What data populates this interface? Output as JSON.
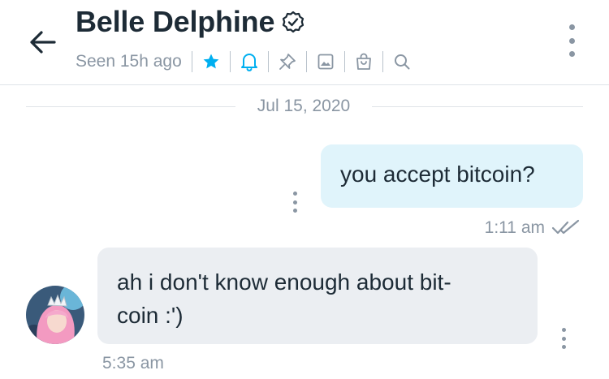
{
  "header": {
    "contact_name": "Belle Delphine",
    "status": "Seen 15h ago",
    "toolbar": [
      {
        "icon": "star-icon",
        "color": "#00aff0"
      },
      {
        "icon": "bell-icon",
        "color": "#00aff0"
      },
      {
        "icon": "pin-icon",
        "color": "#8a96a3"
      },
      {
        "icon": "image-icon",
        "color": "#8a96a3"
      },
      {
        "icon": "shopping-bag-icon",
        "color": "#8a96a3"
      },
      {
        "icon": "search-icon",
        "color": "#8a96a3"
      }
    ]
  },
  "conversation": {
    "date_divider": "Jul 15, 2020",
    "messages": [
      {
        "direction": "sent",
        "text": "you accept bitcoin?",
        "time": "1:11 am",
        "read": true
      },
      {
        "direction": "received",
        "text": "ah i don't know enough about bit-\ncoin :')",
        "time": "5:35 am"
      }
    ]
  },
  "colors": {
    "accent": "#00aff0",
    "sent_bubble": "#e0f4fb",
    "received_bubble": "#ebeef2",
    "muted_text": "#8a96a3",
    "primary_text": "#1d2b36"
  }
}
